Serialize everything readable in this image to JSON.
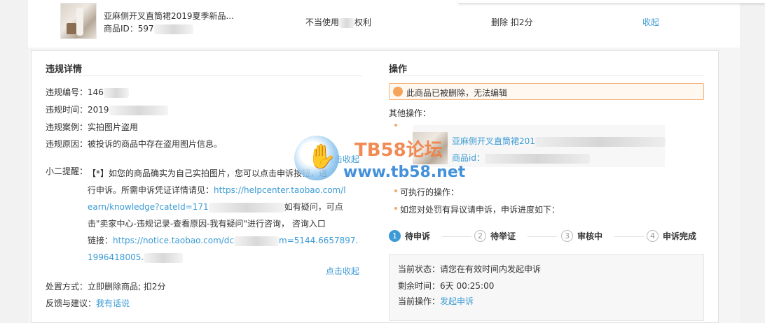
{
  "top_item": {
    "title": "亚麻侧开叉直筒裙2019夏季新品...",
    "id_label": "商品ID：",
    "id_value": "597",
    "violation_type_prefix": "不当使用",
    "violation_type_suffix": "权利",
    "penalty": "删除 扣2分",
    "collapse": "收起"
  },
  "details": {
    "section_title": "违规详情",
    "rows": [
      {
        "label": "违规编号：",
        "value": "146"
      },
      {
        "label": "违规时间：",
        "value": "2019"
      },
      {
        "label": "违规案例：",
        "value": "实拍图片盗用"
      },
      {
        "label": "违规原因：",
        "value": "被投诉的商品中存在盗用图片信息。"
      }
    ],
    "collapse_small": "点击收起",
    "reminder_label": "小二提醒：",
    "reminder_line1": "【*】如您的商品确实为自己实拍图片，您可以点击申诉按钮，进",
    "reminder_line2_text": "行申诉。所需申诉凭证详情请见：",
    "reminder_line2_link": "https://helpcenter.taobao.com/l",
    "reminder_line3_link": "earn/knowledge?cateId=171",
    "reminder_line3_text": "如有疑问，可点",
    "reminder_line4": "击\"卖家中心-违规记录-查看原因-我有疑问\"进行咨询， 咨询入口",
    "reminder_line5_text": "链接：",
    "reminder_line5_link_a": "https://notice.taobao.com/dc",
    "reminder_line5_link_b": "m=5144.6657897.",
    "reminder_line6_link": "1996418005.",
    "collapse_bottom": "点击收起",
    "handling_label": "处置方式：",
    "handling_value": "立即删除商品; 扣2分",
    "feedback_label": "反馈与建议：",
    "feedback_link": "我有话说"
  },
  "operations": {
    "section_title": "操作",
    "alert": "此商品已被删除，无法编辑",
    "other_label": "其他操作：",
    "mini_title": "亚麻侧开叉直筒裙201",
    "mini_id": "商品id：",
    "exec_label": "可执行的操作：",
    "appeal_label": "如您对处罚有异议请申诉，申诉进度如下：",
    "steps": [
      {
        "num": "1",
        "label": "待申诉"
      },
      {
        "num": "2",
        "label": "待举证"
      },
      {
        "num": "3",
        "label": "审核中"
      },
      {
        "num": "4",
        "label": "申诉完成"
      }
    ],
    "status": {
      "state_label": "当前状态：",
      "state_value": "请您在有效时间内发起申诉",
      "remaining_label": "剩余时间：",
      "remaining_value": "6天 00:25:00",
      "op_label": "当前操作：",
      "op_link": "发起申诉"
    }
  },
  "watermark": {
    "title": "TB58论坛",
    "url": "www.tb58.net"
  },
  "colors": {
    "link": "#3c9bd5",
    "alert_border": "#f5b27a",
    "step_active": "#3c9bd5"
  }
}
